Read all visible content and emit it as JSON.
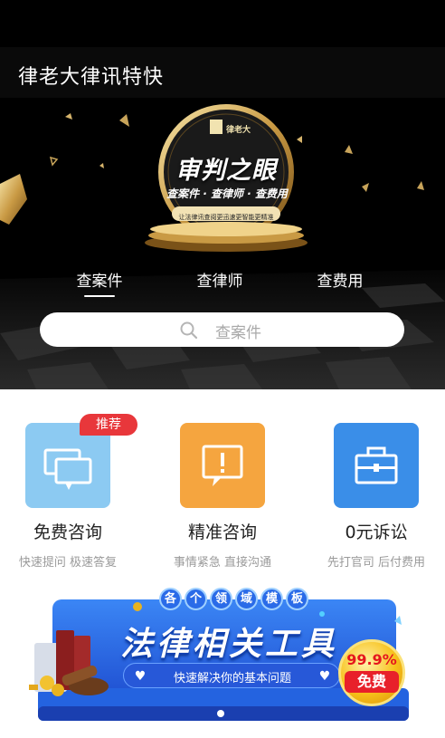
{
  "header": {
    "title": "律老大律讯特快"
  },
  "hero": {
    "emblem_brand": "律老大",
    "emblem_title": "审判之眼",
    "emblem_tags": "查案件 · 查律师 · 查费用",
    "emblem_sub": "让法律讯查阅更迅速更智能更精准",
    "tabs": [
      "查案件",
      "查律师",
      "查费用"
    ],
    "active_tab": "查案件"
  },
  "search": {
    "placeholder": "查案件",
    "icon": "search-icon"
  },
  "services": [
    {
      "name": "免费咨询",
      "desc": "快速提问 极速答复",
      "badge": "推荐",
      "icon": "chat-bubbles-icon",
      "color": "#8ccaf2"
    },
    {
      "name": "精准咨询",
      "desc": "事情紧急 直接沟通",
      "icon": "alert-message-icon",
      "color": "#f5a53f"
    },
    {
      "name": "0元诉讼",
      "desc": "先打官司 后付费用",
      "icon": "briefcase-icon",
      "color": "#3a8ee8"
    }
  ],
  "banner": {
    "chips": [
      "各",
      "个",
      "领",
      "域",
      "模",
      "板"
    ],
    "title": "法律相关工具",
    "subtitle": "快速解决你的基本问题",
    "coin_percent": "99.9%",
    "coin_label": "免费",
    "accent": "#2463e0"
  }
}
